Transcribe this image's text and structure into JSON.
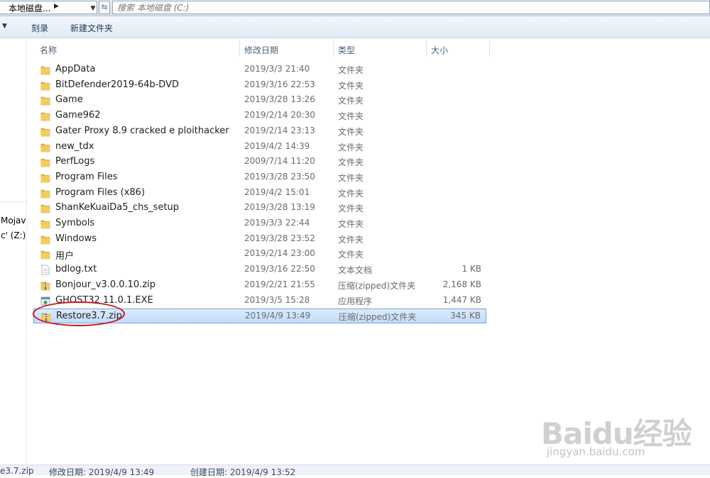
{
  "address": {
    "path": "本地磁盘...",
    "separator_icon": "chevron-right-icon"
  },
  "search": {
    "placeholder": "搜索 本地磁盘 (C:)"
  },
  "toolbar": {
    "burn_label": "刻录",
    "new_folder_label": "新建文件夹"
  },
  "nav": {
    "items": [
      "Mojav",
      "c' (Z:)"
    ]
  },
  "columns": {
    "name": "名称",
    "modified": "修改日期",
    "type": "类型",
    "size": "大小"
  },
  "files": [
    {
      "name": "AppData",
      "modified": "2019/3/3 21:40",
      "type": "文件夹",
      "size": "",
      "icon": "folder-icon"
    },
    {
      "name": "BitDefender2019-64b-DVD",
      "modified": "2019/3/16 22:53",
      "type": "文件夹",
      "size": "",
      "icon": "folder-icon"
    },
    {
      "name": "Game",
      "modified": "2019/3/28 13:26",
      "type": "文件夹",
      "size": "",
      "icon": "folder-icon"
    },
    {
      "name": "Game962",
      "modified": "2019/2/14 20:30",
      "type": "文件夹",
      "size": "",
      "icon": "folder-icon"
    },
    {
      "name": "Gater Proxy 8.9 cracked e ploithacker",
      "modified": "2019/2/14 23:13",
      "type": "文件夹",
      "size": "",
      "icon": "folder-icon"
    },
    {
      "name": "new_tdx",
      "modified": "2019/4/2 14:39",
      "type": "文件夹",
      "size": "",
      "icon": "folder-icon"
    },
    {
      "name": "PerfLogs",
      "modified": "2009/7/14 11:20",
      "type": "文件夹",
      "size": "",
      "icon": "folder-icon"
    },
    {
      "name": "Program Files",
      "modified": "2019/3/28 23:50",
      "type": "文件夹",
      "size": "",
      "icon": "folder-icon"
    },
    {
      "name": "Program Files (x86)",
      "modified": "2019/4/2 15:01",
      "type": "文件夹",
      "size": "",
      "icon": "folder-icon"
    },
    {
      "name": "ShanKeKuaiDa5_chs_setup",
      "modified": "2019/3/28 13:19",
      "type": "文件夹",
      "size": "",
      "icon": "folder-icon"
    },
    {
      "name": "Symbols",
      "modified": "2019/3/3 22:44",
      "type": "文件夹",
      "size": "",
      "icon": "folder-icon"
    },
    {
      "name": "Windows",
      "modified": "2019/3/28 23:52",
      "type": "文件夹",
      "size": "",
      "icon": "folder-icon"
    },
    {
      "name": "用户",
      "modified": "2019/2/14 23:00",
      "type": "文件夹",
      "size": "",
      "icon": "folder-icon"
    },
    {
      "name": "bdlog.txt",
      "modified": "2019/3/16 22:50",
      "type": "文本文档",
      "size": "1 KB",
      "icon": "text-file-icon"
    },
    {
      "name": "Bonjour_v3.0.0.10.zip",
      "modified": "2019/2/21 21:55",
      "type": "压缩(zipped)文件夹",
      "size": "2,168 KB",
      "icon": "zip-folder-icon"
    },
    {
      "name": "GHOST32 11.0.1.EXE",
      "modified": "2019/3/5 15:28",
      "type": "应用程序",
      "size": "1,447 KB",
      "icon": "exe-icon"
    },
    {
      "name": "Restore3.7.zip",
      "modified": "2019/4/9 13:49",
      "type": "压缩(zipped)文件夹",
      "size": "345 KB",
      "icon": "zip-folder-icon",
      "selected": true
    }
  ],
  "status": {
    "name": "e3.7.zip",
    "modified_label": "修改日期: 2019/4/9 13:49",
    "created_label": "创建日期: 2019/4/9 13:52"
  },
  "watermark": {
    "text": "Baidu经验",
    "sub": "jingyan.baidu.com"
  },
  "colors": {
    "selection": "#cce4fc",
    "highlight_circle": "#c8161d",
    "folder": "#e8b93f"
  }
}
